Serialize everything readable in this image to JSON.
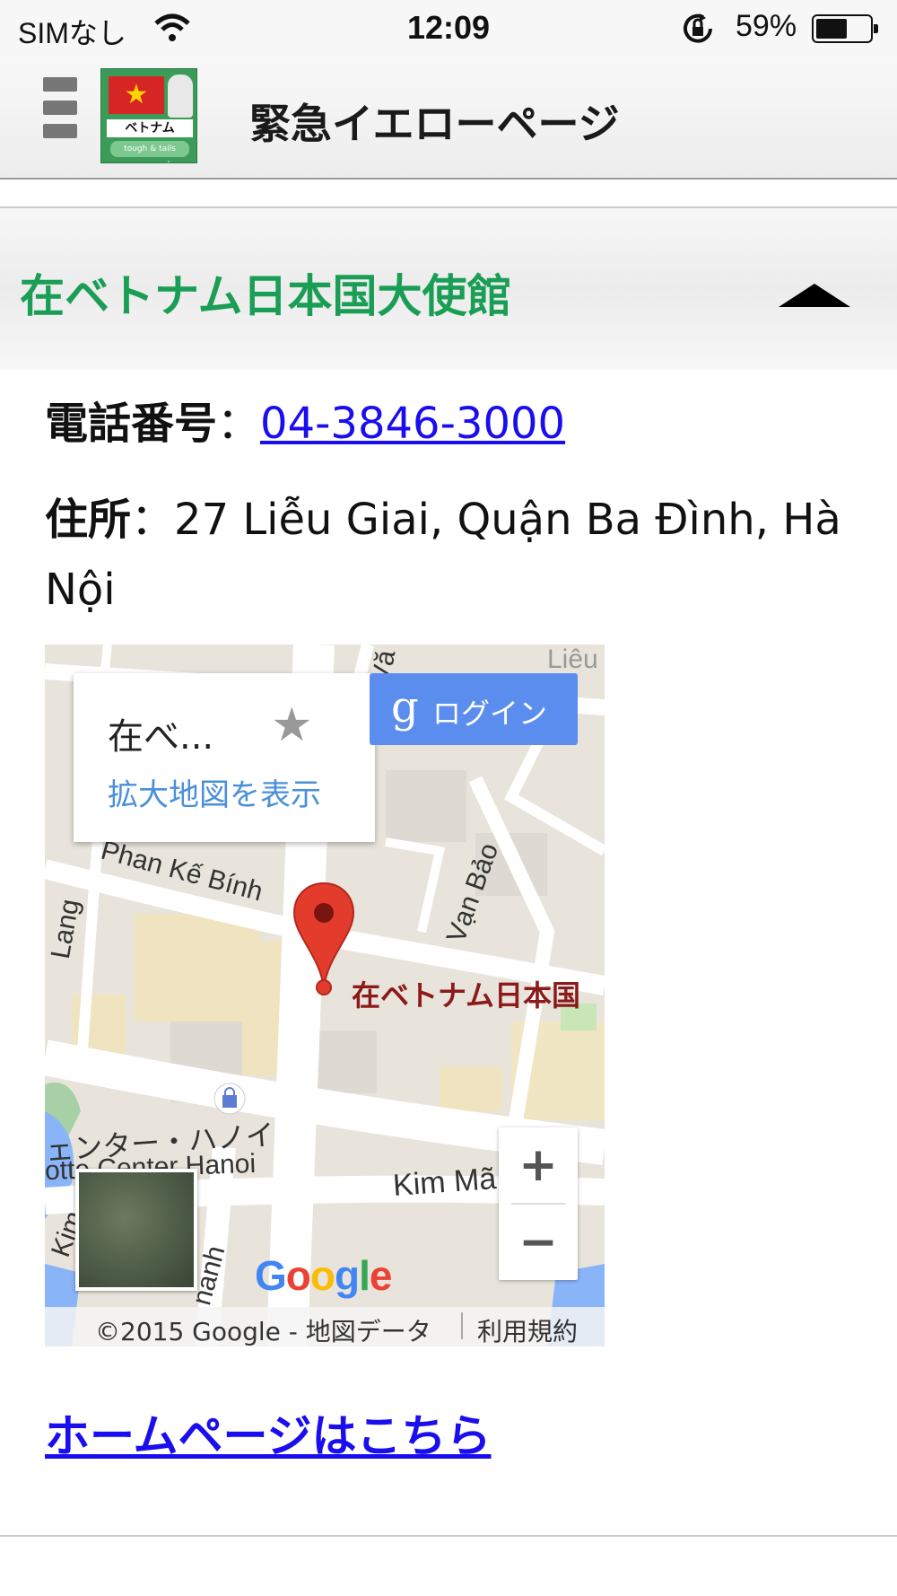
{
  "status_bar": {
    "carrier": "SIMなし",
    "time": "12:09",
    "battery_percent": "59%",
    "battery_level": 0.59
  },
  "header": {
    "title": "緊急イエローページ",
    "logo_band": "ベトナム",
    "logo_sub": "tough & tails personnel"
  },
  "section": {
    "title": "在ベトナム日本国大使館",
    "expanded": true
  },
  "contact": {
    "phone_label": "電話番号",
    "phone_sep": "：",
    "phone_value": "04-3846-3000",
    "address_label": "住所",
    "address_sep": "：",
    "address_value": "27 Liễu Giai, Quận Ba Đình, Hà Nội"
  },
  "map": {
    "info_name": "在べ...",
    "info_link": "拡大地図を表示",
    "login_label": "ログイン",
    "pin_label": "在ベトナム日本国",
    "streets": [
      "Phan Kế Bính",
      "Vạn Bảo",
      "Kim Mã",
      "Lang",
      "ェンター・ハノイ",
      "otte Center Hanoi",
      "nanh",
      "Liêu",
      "Vă",
      "Kim"
    ],
    "zoom_in": "+",
    "zoom_out": "−",
    "google_logo": "Google",
    "copyright": "©2015 Google - 地図データ",
    "terms": "利用規約"
  },
  "homepage_link": "ホームページはこちら",
  "colors": {
    "section_title": "#1a9e55",
    "link": "#1a0dee",
    "pin": "#e33b2c",
    "login_button": "#5b8def"
  }
}
